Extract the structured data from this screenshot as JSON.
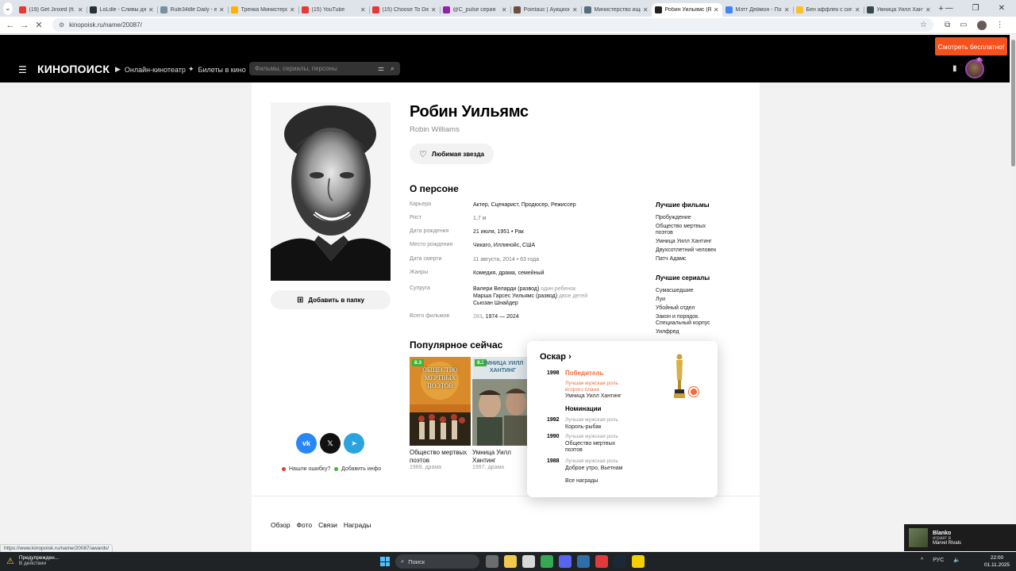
{
  "browser": {
    "tabs": [
      {
        "title": "(19) Get Jinxed (ft.",
        "color": "#e53935"
      },
      {
        "title": "LoLdle - Сливы дня",
        "color": "#263238"
      },
      {
        "title": "Rule34dle Daily - ei",
        "color": "#78909c"
      },
      {
        "title": "Тренка Министерст",
        "color": "#ffb300"
      },
      {
        "title": "(15) YouTube",
        "color": "#e53935"
      },
      {
        "title": "(15) Choose To Die",
        "color": "#e53935"
      },
      {
        "title": "@C_pulse серия",
        "color": "#8e24aa"
      },
      {
        "title": "Pointauc | Аукцион",
        "color": "#6d4c41"
      },
      {
        "title": "Министерство ищет",
        "color": "#546e7a"
      },
      {
        "title": "Робин Уильямс (Ro",
        "color": "#212121"
      },
      {
        "title": "Мэтт Деймон - Пои",
        "color": "#4285f4"
      },
      {
        "title": "Бен аффлек с сигар",
        "color": "#fbc02d"
      },
      {
        "title": "Умница Уилл Хантин",
        "color": "#37474f"
      }
    ],
    "active_tab": 9,
    "url": "kinopoisk.ru/name/20087/",
    "status_url": "https://www.kinopoisk.ru/name/20087/awards/"
  },
  "header": {
    "logo": "КИНОПОИСК",
    "nav": [
      "Онлайн-кинотеатр",
      "Билеты в кино"
    ],
    "search_placeholder": "Фильмы, сериалы, персоны",
    "watch_button": "Смотреть бесплатно!",
    "avatar_badge": "0"
  },
  "person": {
    "name_ru": "Робин Уильямс",
    "name_en": "Robin Williams",
    "fav_button": "Любимая звезда",
    "add_folder": "Добавить в папку",
    "about_title": "О персоне",
    "info": [
      {
        "k": "Карьера",
        "v": "Актер, Сценарист, Продюсер, Режиссер"
      },
      {
        "k": "Рост",
        "v": "1,7 м"
      },
      {
        "k": "Дата рождения",
        "v": "21 июля, 1951 • Рак"
      },
      {
        "k": "Место рождения",
        "v": "Чикаго, Иллинойс, США"
      },
      {
        "k": "Дата смерти",
        "v": "11 августа, 2014 • 63 года"
      },
      {
        "k": "Жанры",
        "v": "Комедия, драма, семейный"
      }
    ],
    "spouse_label": "Супруга",
    "spouses": [
      {
        "name": "Валери Веларди (развод)",
        "note": "один ребенок"
      },
      {
        "name": "Маршa Гарсес Уильямс (развод)",
        "note": "двое детей"
      },
      {
        "name": "Сьюзан Шнайдер",
        "note": ""
      }
    ],
    "films_label": "Всего фильмов",
    "films_count": "283",
    "films_years": ", 1974 — 2024"
  },
  "best_films": {
    "title": "Лучшие фильмы",
    "items": [
      "Пробуждение",
      "Общество мертвых поэтов",
      "Умница Уилл Хантинг",
      "Двухсотлетний человек",
      "Патч Адамс"
    ]
  },
  "best_series": {
    "title": "Лучшие сериалы",
    "items": [
      "Сумасшедшие",
      "Луи",
      "Убойный отдел",
      "Закон и порядок. Специальный корпус",
      "Уилфред"
    ]
  },
  "popular": {
    "title": "Популярное сейчас",
    "items": [
      {
        "rating": "8.3",
        "poster_text": "ОБЩЕСТВО МЕРТВЫХ ПОЭТОВ",
        "title": "Общество мертвых поэтов",
        "meta": "1989, драма"
      },
      {
        "rating": "8.3",
        "poster_text": "УМНИЦА УИЛЛ ХАНТИНГ",
        "title": "Умница Уилл Хантинг",
        "meta": "1997, драма"
      }
    ]
  },
  "share": {
    "vk": "vk",
    "x": "𝕏",
    "tg": "➤",
    "report_error": "Нашли ошибку?",
    "add_info": "Добавить инфо"
  },
  "bottom_tabs": [
    "Обзор",
    "Фото",
    "Связи",
    "Награды"
  ],
  "oscar": {
    "title": "Оскар",
    "winner_year": "1998",
    "winner_label": "Победитель",
    "winner_cat": "Лучшая мужская роль второго плана",
    "winner_film": "Умница Уилл Хантинг",
    "nom_label": "Номинации",
    "noms": [
      {
        "year": "1992",
        "cat": "Лучшая мужская роль",
        "film": "Король-рыбак"
      },
      {
        "year": "1990",
        "cat": "Лучшая мужская роль",
        "film": "Общество мертвых поэтов"
      },
      {
        "year": "1988",
        "cat": "Лучшая мужская роль",
        "film": "Доброе утро, Вьетнам"
      }
    ],
    "all_awards": "Все награды"
  },
  "notification": {
    "user": "Blanko",
    "line2": "играет в",
    "game": "Marvel Rivals"
  },
  "taskbar": {
    "warn_title": "Предупрежден...",
    "warn_sub": "В действии",
    "search": "Поиск",
    "lang": "РУС",
    "time": "22:00",
    "date": "01.11.2025"
  },
  "colors": {
    "accent": "#f5511c",
    "win": "#f46b3a",
    "rating": "#3bb33b"
  }
}
